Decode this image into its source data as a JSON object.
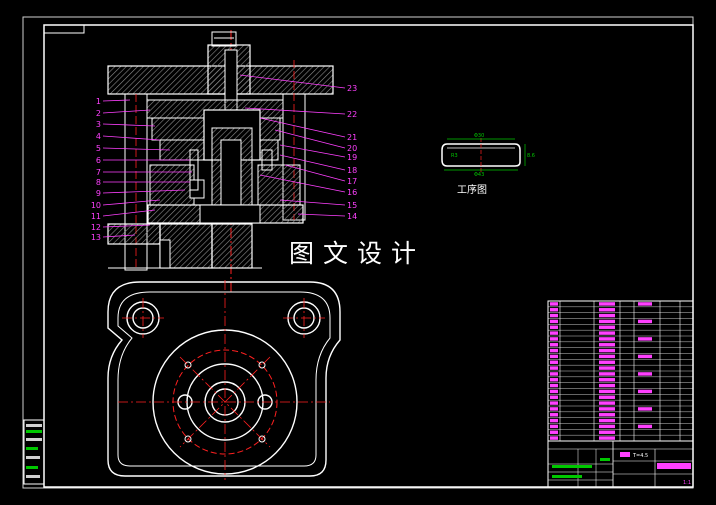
{
  "watermark_text": "图文设计",
  "process_label": "工序图",
  "process_dims": {
    "top": "Φ30",
    "side": "8.6",
    "bottom": "Φ43",
    "left": "R3"
  },
  "callouts_left": [
    "1",
    "2",
    "3",
    "4",
    "5",
    "6",
    "7",
    "8",
    "9",
    "10",
    "11",
    "12",
    "13"
  ],
  "callouts_right": [
    "23",
    "22",
    "21",
    "20",
    "19",
    "18",
    "17",
    "16",
    "15",
    "14"
  ],
  "title_block": {
    "thickness": "T=4.5",
    "scale": "1:1"
  },
  "colors": {
    "background": "#000000",
    "line": "#ffffff",
    "centerline": "#ff2020",
    "leader": "#ff40ff",
    "hatch": "#9a9a9a",
    "table": "#ffffff",
    "table_text": "#ff40ff",
    "title_green": "#00c800"
  }
}
